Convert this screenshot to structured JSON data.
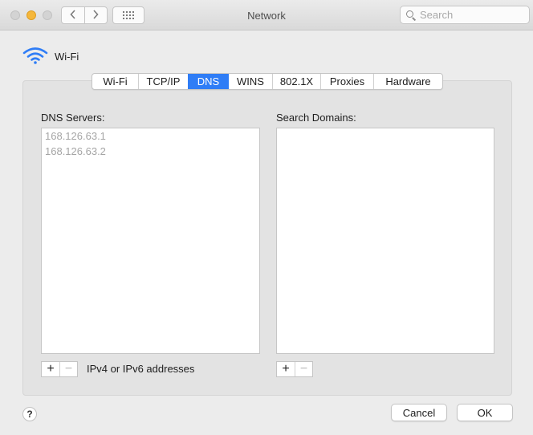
{
  "window": {
    "title": "Network",
    "search_placeholder": "Search"
  },
  "toolbar": {
    "back_icon": "chevron-left",
    "forward_icon": "chevron-right",
    "show_all_icon": "grid"
  },
  "service": {
    "name": "Wi-Fi",
    "icon": "wifi-icon",
    "icon_color": "#2f7df6"
  },
  "tabs": [
    {
      "label": "Wi-Fi",
      "active": false
    },
    {
      "label": "TCP/IP",
      "active": false
    },
    {
      "label": "DNS",
      "active": true
    },
    {
      "label": "WINS",
      "active": false
    },
    {
      "label": "802.1X",
      "active": false
    },
    {
      "label": "Proxies",
      "active": false
    },
    {
      "label": "Hardware",
      "active": false
    }
  ],
  "dns": {
    "label": "DNS Servers:",
    "entries": [
      "168.126.63.1",
      "168.126.63.2"
    ],
    "hint": "IPv4 or IPv6 addresses"
  },
  "search_domains": {
    "label": "Search Domains:",
    "entries": []
  },
  "buttons": {
    "plus": "+",
    "minus": "−",
    "help": "?",
    "cancel": "Cancel",
    "ok": "OK"
  },
  "colors": {
    "accent": "#2f7df6",
    "minimize": "#f5b73b"
  }
}
